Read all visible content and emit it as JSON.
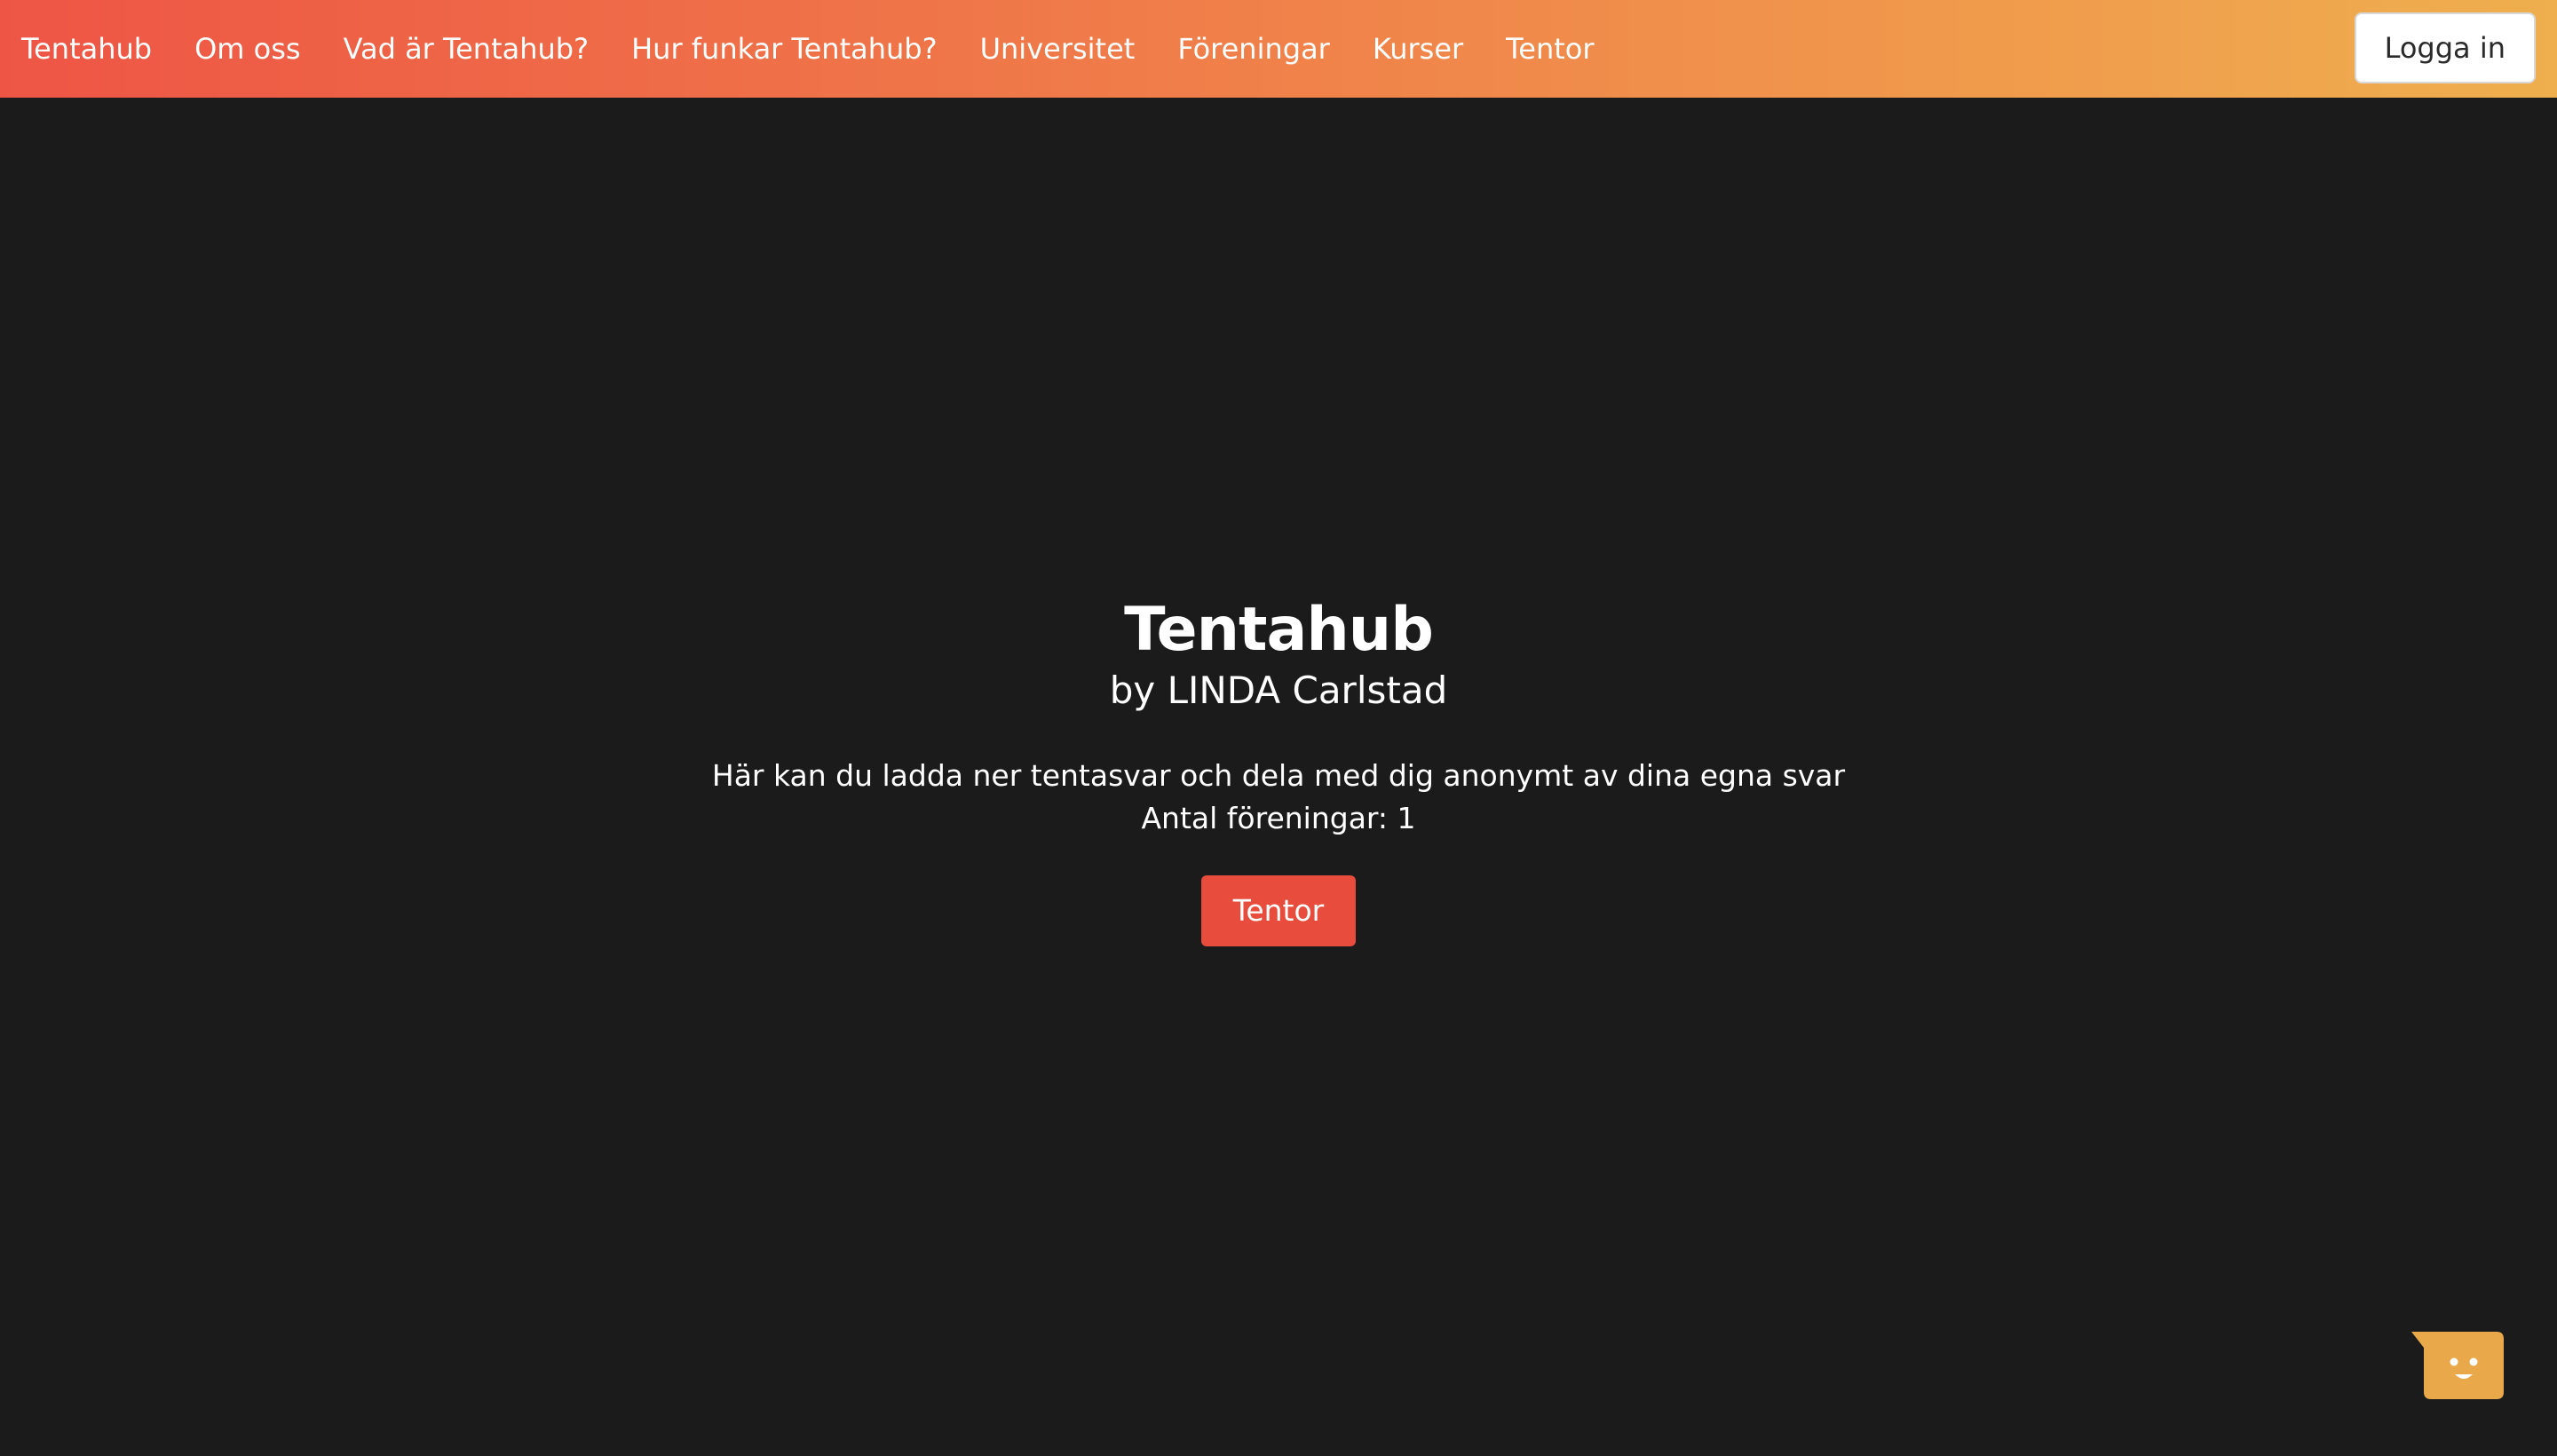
{
  "nav": {
    "items": [
      {
        "label": "Tentahub"
      },
      {
        "label": "Om oss"
      },
      {
        "label": "Vad är Tentahub?"
      },
      {
        "label": "Hur funkar Tentahub?"
      },
      {
        "label": "Universitet"
      },
      {
        "label": "Föreningar"
      },
      {
        "label": "Kurser"
      },
      {
        "label": "Tentor"
      }
    ],
    "login_label": "Logga in"
  },
  "hero": {
    "title": "Tentahub",
    "subtitle": "by LINDA Carlstad",
    "description": "Här kan du ladda ner tentasvar och dela med dig anonymt av dina egna svar",
    "count_text": "Antal föreningar: 1",
    "cta_label": "Tentor"
  },
  "chat_widget": {
    "icon": "chat-smiley-icon"
  },
  "colors": {
    "background": "#1b1b1b",
    "nav_gradient_start": "#ee5545",
    "nav_gradient_end": "#efaf4e",
    "cta": "#e74c3c",
    "chat_widget": "#e9a94b"
  }
}
